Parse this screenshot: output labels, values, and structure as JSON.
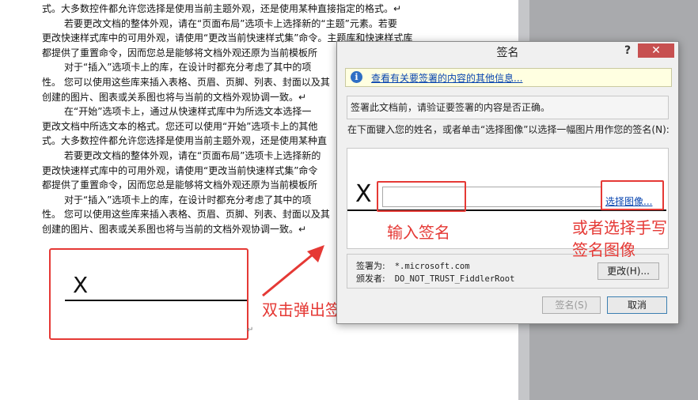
{
  "document": {
    "lines": [
      {
        "text": "式。大多数控件都允许您选择是使用当前主题外观，还是使用某种直接指定的格式。↵",
        "indent": false
      },
      {
        "text": "若要更改文档的整体外观，请在“页面布局”选项卡上选择新的“主题”元素。若要",
        "indent": true
      },
      {
        "text": "更改快速样式库中的可用外观，请使用“更改当前快速样式集”命令。主题库和快速样式库",
        "indent": false
      },
      {
        "text": "都提供了重置命令，因而您总是能够将文档外观还原为当前模板所",
        "indent": false
      },
      {
        "text": "对于“插入”选项卡上的库，在设计时都充分考虑了其中的项",
        "indent": true
      },
      {
        "text": "性。 您可以使用这些库来插入表格、页眉、页脚、列表、封面以及其",
        "indent": false
      },
      {
        "text": "创建的图片、图表或关系图也将与当前的文档外观协调一致。↵",
        "indent": false
      },
      {
        "text": "在“开始”选项卡上，通过从快速样式库中为所选文本选择一",
        "indent": true
      },
      {
        "text": "更改文档中所选文本的格式。您还可以使用“开始”选项卡上的其他",
        "indent": false
      },
      {
        "text": "式。大多数控件都允许您选择是使用当前主题外观，还是使用某种直",
        "indent": false
      },
      {
        "text": "若要更改文档的整体外观，请在“页面布局”选项卡上选择新的",
        "indent": true
      },
      {
        "text": "更改快速样式库中的可用外观，请使用“更改当前快速样式集”命令",
        "indent": false
      },
      {
        "text": "都提供了重置命令，因而您总是能够将文档外观还原为当前模板所",
        "indent": false
      },
      {
        "text": "对于“插入”选项卡上的库，在设计时都充分考虑了其中的项",
        "indent": true
      },
      {
        "text": "性。 您可以使用这些库来插入表格、页眉、页脚、列表、封面以及其",
        "indent": false
      },
      {
        "text": "创建的图片、图表或关系图也将与当前的文档外观协调一致。↵",
        "indent": false
      }
    ],
    "signature_line_x": "X",
    "paragraph_mark": "↵"
  },
  "annotations": {
    "double_click": "双击弹出签名框",
    "enter_signature": "输入签名",
    "or_select_line1": "或者选择手写",
    "or_select_line2": "签名图像"
  },
  "dialog": {
    "title": "签名",
    "help": "?",
    "close": "✕",
    "info_icon": "i",
    "info_link": "查看有关要签署的内容的其他信息...",
    "verify_text": "签署此文档前，请验证要签署的内容是否正确。",
    "enter_text": "在下面键入您的姓名，或者单击“选择图像”以选择一幅图片用作您的签名(N):",
    "sig_x": "X",
    "signature_value": "",
    "select_image_link": "选择图像...",
    "signer_label": "签署为:",
    "signer_value": "*.microsoft.com",
    "issuer_label": "颁发者:",
    "issuer_value": "DO_NOT_TRUST_FiddlerRoot",
    "change_button": "更改(H)...",
    "sign_button": "签名(S)",
    "cancel_button": "取消"
  },
  "colors": {
    "annotation_red": "#e53935",
    "link_blue": "#0a46b0",
    "close_red": "#c75050"
  }
}
